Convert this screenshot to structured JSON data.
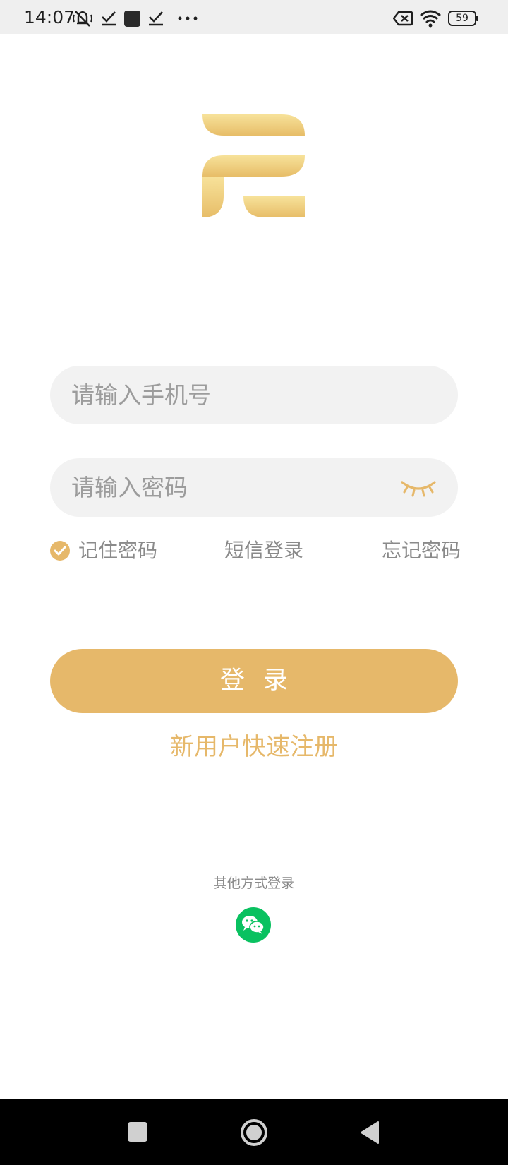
{
  "status_bar": {
    "time": "14:07",
    "battery": "59",
    "icons": [
      "mute-icon",
      "check-icon",
      "square-icon",
      "check-icon",
      "more-dots-icon",
      "no-sim-icon",
      "wifi-icon",
      "battery-icon"
    ]
  },
  "logo": {
    "icon": "app-logo"
  },
  "phone_field": {
    "placeholder": "请输入手机号",
    "value": ""
  },
  "password_field": {
    "placeholder": "请输入密码",
    "value": "",
    "toggle_icon": "eye-closed-icon"
  },
  "options": {
    "remember_label": "记住密码",
    "remember_checked": true,
    "sms_login_label": "短信登录",
    "forgot_label": "忘记密码"
  },
  "login_button": {
    "label": "登录"
  },
  "register_link": {
    "label": "新用户快速注册"
  },
  "other_login": {
    "label": "其他方式登录",
    "icon": "wechat-icon"
  },
  "nav_bar": {
    "icons": [
      "recent-apps-icon",
      "home-icon",
      "back-icon"
    ]
  },
  "colors": {
    "accent": "#e6b86a",
    "field_bg": "#f2f2f2",
    "placeholder": "#9c9c9c",
    "wechat": "#09c160"
  }
}
